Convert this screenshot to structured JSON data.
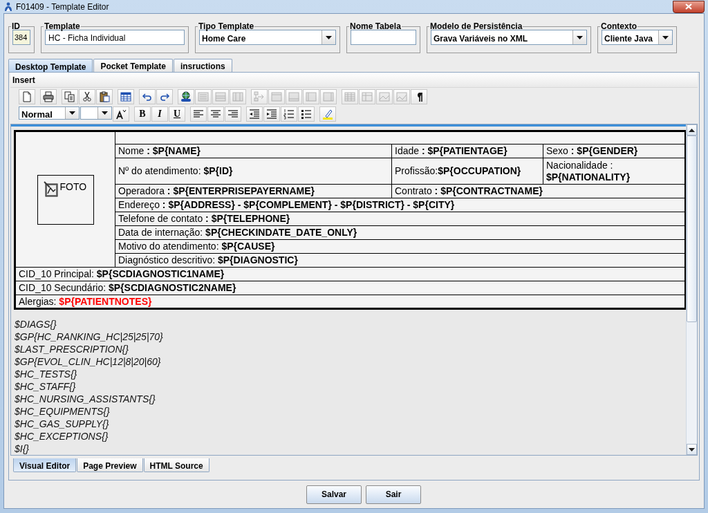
{
  "window": {
    "title": "F01409 - Template Editor"
  },
  "fields": [
    {
      "kind": "readonly",
      "label": "ID",
      "value": "384"
    },
    {
      "kind": "text",
      "label": "Template",
      "value": "HC - Ficha Individual"
    },
    {
      "kind": "combo",
      "label": "Tipo Template",
      "value": "Home Care"
    },
    {
      "kind": "text",
      "label": "Nome Tabela"
    },
    {
      "kind": "combo",
      "label": "Modelo de Persistência",
      "value": "Grava Variáveis no XML"
    },
    {
      "kind": "combo",
      "label": "Contexto",
      "value": "Cliente Java"
    }
  ],
  "tabs": [
    {
      "label": "Desktop Template",
      "selected": true
    },
    {
      "label": "Pocket Template",
      "selected": false
    },
    {
      "label": "insructions",
      "selected": false
    }
  ],
  "menu": [
    {
      "label": "Insert"
    }
  ],
  "toolbar": [
    [
      {
        "disabled": false
      }
    ],
    [
      {
        "disabled": false
      }
    ],
    [
      {
        "disabled": false
      },
      {
        "disabled": false
      },
      {
        "disabled": false
      }
    ],
    [
      {
        "disabled": false
      }
    ],
    [
      {
        "disabled": false
      },
      {
        "disabled": false
      }
    ],
    [
      {
        "disabled": false
      },
      {
        "disabled": true
      },
      {
        "disabled": true
      },
      {
        "disabled": true
      }
    ],
    [
      {
        "disabled": true
      },
      {
        "disabled": true
      },
      {
        "disabled": true
      },
      {
        "disabled": true
      },
      {
        "disabled": true
      }
    ],
    [
      {
        "disabled": true
      },
      {
        "disabled": true
      },
      {
        "disabled": true
      },
      {
        "disabled": true
      },
      {
        "disabled": false
      }
    ]
  ],
  "format_bar": {
    "style": "Normal",
    "text_buttons": [
      {
        "label": "B"
      },
      {
        "label": "I"
      },
      {
        "label": "U"
      }
    ]
  },
  "document": {
    "photo_label": "FOTO",
    "rows": [
      [
        {
          "colspan": 3
        }
      ],
      [
        {
          "label": "Nome ",
          "value": ": $P{NAME}"
        },
        {
          "label": "Idade ",
          "value": ": $P{PATIENTAGE}"
        },
        {
          "label": "Sexo ",
          "value": ": $P{GENDER}"
        }
      ],
      [
        {
          "label": "Nº do atendimento: ",
          "value": "$P{ID}"
        },
        {
          "label": "Profissão:",
          "value": "$P{OCCUPATION}"
        },
        {
          "label": "Nacionalidade : ",
          "value": "$P{NATIONALITY}"
        }
      ],
      [
        {
          "label": "Operadora ",
          "value": ": $P{ENTERPRISEPAYERNAME}"
        },
        {
          "label": "Contrato ",
          "value": ": $P{CONTRACTNAME}",
          "colspan": 2
        }
      ],
      [
        {
          "label": "Endereço ",
          "value": ": $P{ADDRESS} - $P{COMPLEMENT} - $P{DISTRICT} - $P{CITY}",
          "colspan": 3
        }
      ],
      [
        {
          "label": "Telefone de contato ",
          "value": ": $P{TELEPHONE}",
          "colspan": 3
        }
      ],
      [
        {
          "label": "Data de internação: ",
          "value": "$P{CHECKINDATE_DATE_ONLY}",
          "colspan": 3
        }
      ],
      [
        {
          "label": "Motivo do atendimento: ",
          "value": "$P{CAUSE}",
          "colspan": 3
        }
      ],
      [
        {
          "label": "Diagnóstico descritivo: ",
          "value": "$P{DIAGNOSTIC}",
          "colspan": 3
        }
      ]
    ],
    "footer_rows": [
      {
        "label": "CID_10 Principal: ",
        "value": "$P{SCDIAGNOSTIC1NAME}"
      },
      {
        "label": "CID_10 Secundário: ",
        "value": "$P{SCDIAGNOSTIC2NAME}"
      },
      {
        "label": "Alergias: ",
        "value": "$P{PATIENTNOTES}",
        "color": "#ff0000"
      }
    ]
  },
  "lines": [
    "$DIAGS{}",
    "$GP{HC_RANKING_HC|25|25|70}",
    "$LAST_PRESCRIPTION{}",
    "$GP{EVOL_CLIN_HC|12|8|20|60}",
    "$HC_TESTS{}",
    "$HC_STAFF{}",
    "$HC_NURSING_ASSISTANTS{}",
    "$HC_EQUIPMENTS{}",
    "$HC_GAS_SUPPLY{}",
    "$HC_EXCEPTIONS{}",
    "$I{}"
  ],
  "editor_tabs": [
    {
      "label": "Visual Editor",
      "selected": true
    },
    {
      "label": "Page Preview",
      "selected": false
    },
    {
      "label": "HTML Source",
      "selected": false
    }
  ],
  "buttons": [
    {
      "label": "Salvar"
    },
    {
      "label": "Sair"
    }
  ]
}
